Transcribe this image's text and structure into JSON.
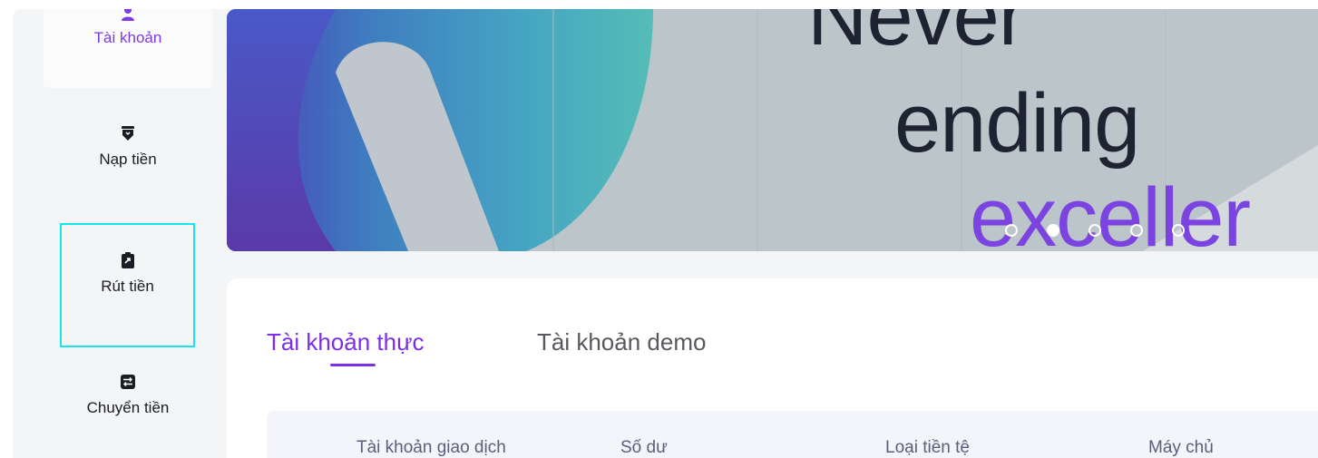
{
  "sidebar": {
    "items": [
      {
        "label": "Tài khoản",
        "icon": "user-icon",
        "state": "active"
      },
      {
        "label": "Nạp tiền",
        "icon": "deposit-icon",
        "state": "normal"
      },
      {
        "label": "Rút tiền",
        "icon": "withdraw-icon",
        "state": "focused"
      },
      {
        "label": "Chuyển tiền",
        "icon": "transfer-icon",
        "state": "normal"
      }
    ]
  },
  "banner": {
    "line1": "Never",
    "line2": "ending",
    "line3": "exceller",
    "slides_total": 5,
    "slide_active": 1
  },
  "tabs": [
    {
      "label": "Tài khoản thực",
      "active": true
    },
    {
      "label": "Tài khoản demo",
      "active": false
    }
  ],
  "table": {
    "columns": [
      "Tài khoản giao dịch",
      "Số dư",
      "Loại tiền tệ",
      "Máy chủ"
    ]
  },
  "colors": {
    "accent": "#7b2fe6",
    "focus_outline": "#16e4ef",
    "sidebar_bg": "#f4f5f7",
    "headline_dark": "#1d2330",
    "headline_purple": "#7b44e0"
  }
}
